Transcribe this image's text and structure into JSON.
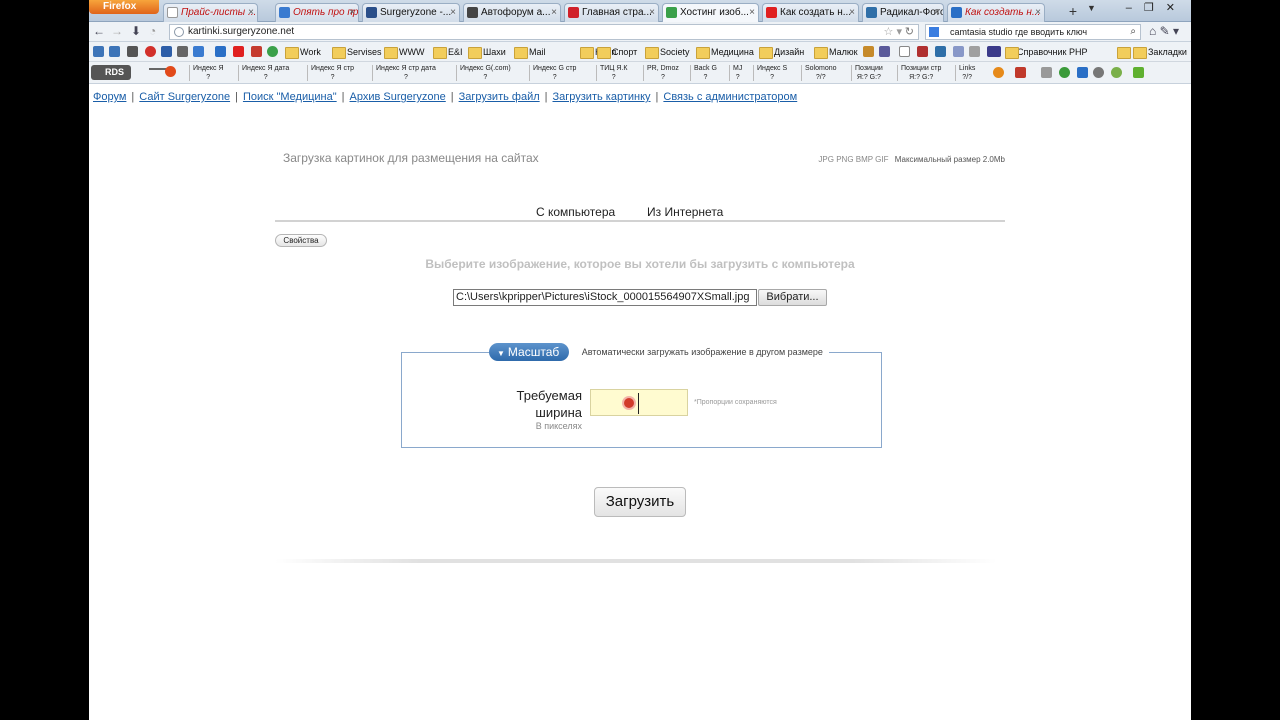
{
  "browser": {
    "menu_button": "Firefox",
    "tabs": [
      {
        "title": "Прайс-листы ...",
        "italic_red": true
      },
      {
        "title": "Опять про пр...",
        "italic_red": true
      },
      {
        "title": "Surgeryzone -...",
        "italic_red": false
      },
      {
        "title": "Автофорум а...",
        "italic_red": false
      },
      {
        "title": "Главная стра...",
        "italic_red": false
      },
      {
        "title": "Хостинг изоб...",
        "italic_red": false,
        "active": true
      },
      {
        "title": "Как создать н...",
        "italic_red": false
      },
      {
        "title": "Радикал-Фото...",
        "italic_red": false
      },
      {
        "title": "Как создать н...",
        "italic_red": true
      }
    ],
    "url": "kartinki.surgeryzone.net",
    "search": "camtasia studio где вводить ключ",
    "bookmarks": [
      "Work",
      "Servises",
      "WWW",
      "E&I",
      "Шахи",
      "Mail",
      "Комп",
      "Спорт",
      "Society",
      "Медицина",
      "Дизайн",
      "Малюк"
    ],
    "bookmarks_extra": "Справочник PHP",
    "bookmarks_menu": "Закладки",
    "rds_label": "RDS",
    "seo": [
      {
        "line1": "Индекс Я",
        "line2": "?"
      },
      {
        "line1": "Индекс Я дата",
        "line2": "?"
      },
      {
        "line1": "Индекс Я стр",
        "line2": "?"
      },
      {
        "line1": "Индекс Я стр дата",
        "line2": "?"
      },
      {
        "line1": "Индекс G(.com)",
        "line2": "?"
      },
      {
        "line1": "Индекс G стр",
        "line2": "?"
      },
      {
        "line1": "ТИЦ Я.К",
        "line2": "?"
      },
      {
        "line1": "PR, Dmoz",
        "line2": "?"
      },
      {
        "line1": "Back G",
        "line2": "?"
      },
      {
        "line1": "MJ",
        "line2": "?"
      },
      {
        "line1": "Индекс S",
        "line2": "?"
      },
      {
        "line1": "Solomono",
        "line2": "?/?"
      },
      {
        "line1": "Позиции",
        "line2": "Я:? G:?"
      },
      {
        "line1": "Позиции стр",
        "line2": "Я:? G:?"
      },
      {
        "line1": "Links",
        "line2": "?/?"
      }
    ]
  },
  "page": {
    "nav": [
      "Форум",
      "Сайт Surgeryzone",
      "Поиск \"Медицина\"",
      "Архив Surgeryzone",
      "Загрузить файл",
      "Загрузить картинку",
      "Связь с администратором"
    ],
    "title": "Загрузка картинок для размещения на сайтах",
    "formats": "JPG PNG BMP GIF",
    "max_size": "Максимальный размер 2.0Mb",
    "tab_computer": "С компьютера",
    "tab_internet": "Из Интернета",
    "properties_button": "Свойства",
    "choose_text": "Выберите изображение, которое вы хотели бы загрузить с компьютера",
    "file_path": "C:\\Users\\kpripper\\Pictures\\iStock_000015564907XSmall.jpg",
    "browse_button": "Вибрати...",
    "scale_toggle": "Масштаб",
    "scale_description": "Автоматически загружать изображение в другом размере",
    "width_label": "Требуемая ширина",
    "width_unit": "В пикселях",
    "width_value": "",
    "proportions_note": "*Пропорции сохраняются",
    "upload_button": "Загрузить"
  },
  "colors": {
    "link": "#1a5ea8",
    "scale_pill": "#3a78b8",
    "width_input_bg": "#fffbd0",
    "muted_text": "#c0c0c0"
  }
}
